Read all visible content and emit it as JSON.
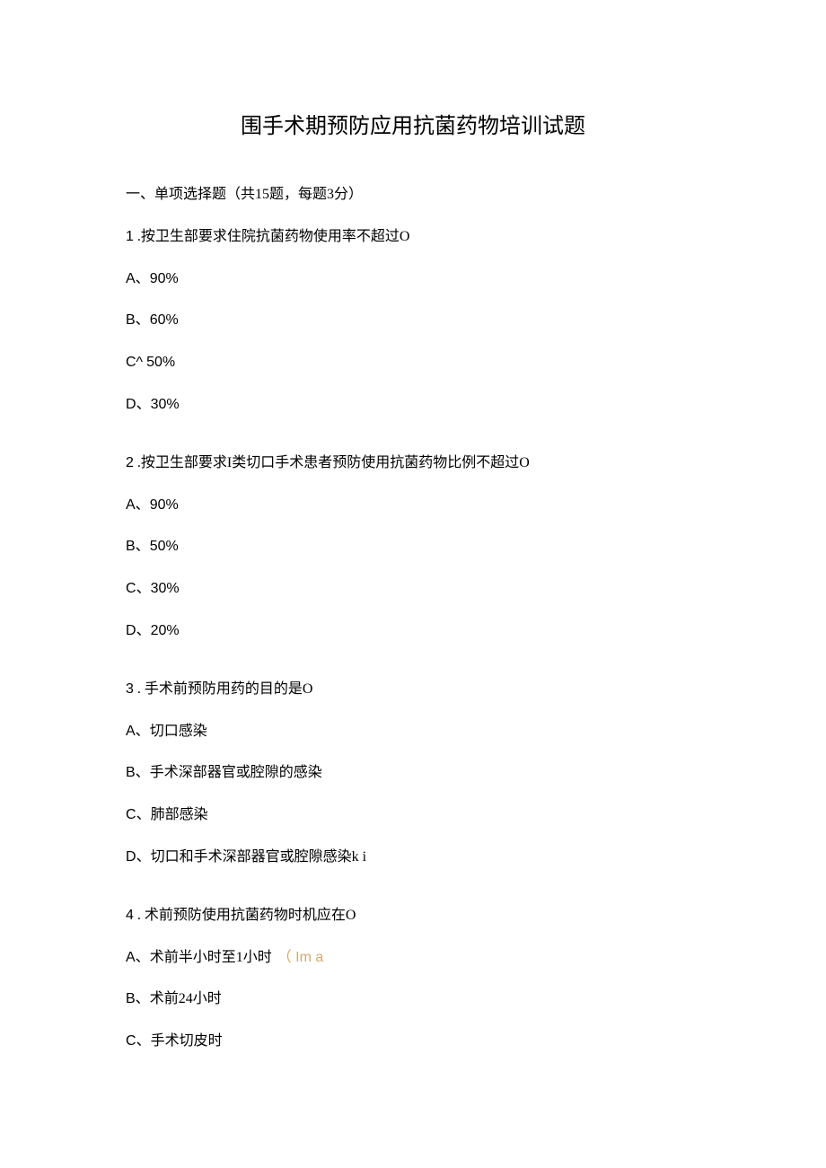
{
  "title": "围手术期预防应用抗菌药物培训试题",
  "section": "一、单项选择题（共15题，每题3分）",
  "questions": [
    {
      "num": "1",
      "sep": " .",
      "text": "按卫生部要求住院抗菌药物使用率不超过O",
      "options": [
        {
          "label": "A",
          "sep": "、",
          "text": "90%",
          "latin": true
        },
        {
          "label": "B",
          "sep": "、",
          "text": "60%",
          "latin": true
        },
        {
          "label": "C^",
          "sep": " ",
          "text": "50%",
          "latin": true,
          "chat": true
        },
        {
          "label": "D",
          "sep": "、",
          "text": "30%",
          "latin": true
        }
      ]
    },
    {
      "num": "2",
      "sep": "  .",
      "text": "按卫生部要求I类切口手术患者预防使用抗菌药物比例不超过O",
      "options": [
        {
          "label": "A",
          "sep": "、",
          "text": "90%",
          "latin": true
        },
        {
          "label": "B",
          "sep": "、",
          "text": "50%",
          "latin": true
        },
        {
          "label": "C",
          "sep": "、",
          "text": "30%",
          "latin": true
        },
        {
          "label": "D",
          "sep": "、",
          "text": "20%",
          "latin": true
        }
      ]
    },
    {
      "num": "3",
      "sep": "  . ",
      "text": "手术前预防用药的目的是O",
      "options": [
        {
          "label": "A",
          "sep": "、",
          "text": "切口感染",
          "latin": false
        },
        {
          "label": "B",
          "sep": "、",
          "text": "手术深部器官或腔隙的感染",
          "latin": false
        },
        {
          "label": "C",
          "sep": "、",
          "text": "肺部感染",
          "latin": false
        },
        {
          "label": "D",
          "sep": "、",
          "text": "切口和手术深部器官或腔隙感染k i",
          "latin": false
        }
      ]
    },
    {
      "num": "4",
      "sep": "  . ",
      "text": "术前预防使用抗菌药物时机应在O",
      "options": [
        {
          "label": "A",
          "sep": "、",
          "text": "术前半小时至1小时",
          "latin": false,
          "annotation": "（  Im a"
        },
        {
          "label": "B",
          "sep": "、",
          "text": "术前24小时",
          "latin": false
        },
        {
          "label": "C",
          "sep": "、",
          "text": "手术切皮时",
          "latin": false
        }
      ]
    }
  ]
}
